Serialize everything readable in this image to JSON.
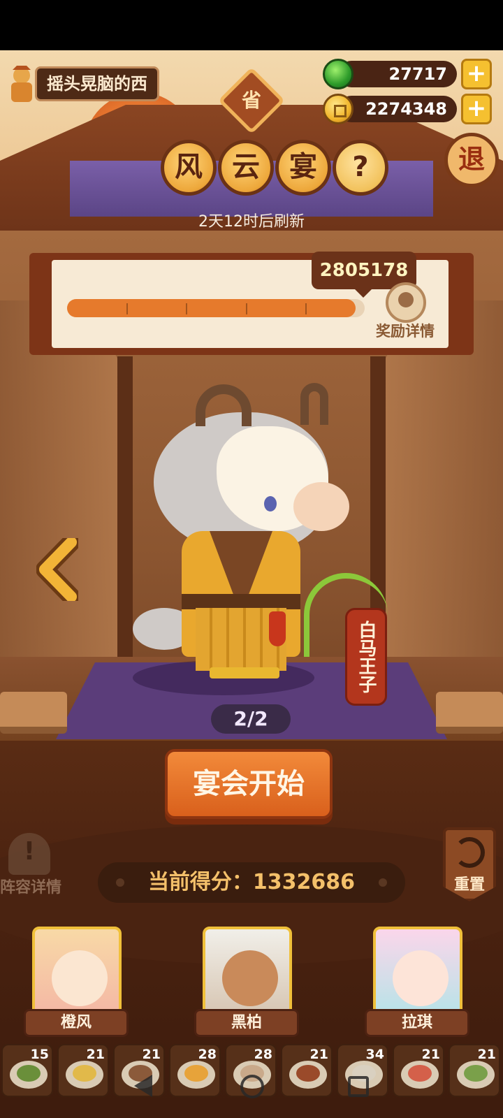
{
  "header": {
    "player_name": "摇头晃脑的西",
    "province_badge": "省",
    "gems": "27717",
    "coins": "2274348",
    "exit_label": "退"
  },
  "event": {
    "title_chars": [
      "风",
      "云",
      "宴"
    ],
    "help_label": "?",
    "refresh_text": "2天12时后刷新"
  },
  "progress": {
    "target_score": "2805178",
    "fill_fraction": 0.97,
    "segments": 5,
    "reward_details_label": "奖励详情"
  },
  "character": {
    "name_tag": "白马王子",
    "counter": "2/2"
  },
  "actions": {
    "start_label": "宴会开始",
    "lineup_label": "阵容详情",
    "reset_label": "重置"
  },
  "score": {
    "text": "当前得分：1332686"
  },
  "heroes": [
    {
      "name": "橙风"
    },
    {
      "name": "黑柏"
    },
    {
      "name": "拉琪"
    }
  ],
  "dishes": [
    {
      "count": "15",
      "color": "#6a8f3a"
    },
    {
      "count": "21",
      "color": "#e1b94a"
    },
    {
      "count": "21",
      "color": "#8b5a3a"
    },
    {
      "count": "28",
      "color": "#e7a33a"
    },
    {
      "count": "28",
      "color": "#c9a98a"
    },
    {
      "count": "21",
      "color": "#9a4a2a"
    },
    {
      "count": "34",
      "color": "#d9d0c0"
    },
    {
      "count": "21",
      "color": "#d4604a"
    },
    {
      "count": "21",
      "color": "#7aa04a"
    }
  ],
  "colors": {
    "accent_orange": "#e67a2c",
    "panel_brown": "#4a2414",
    "rug_purple": "#5b3d7a",
    "name_tag_red": "#b3361d"
  }
}
